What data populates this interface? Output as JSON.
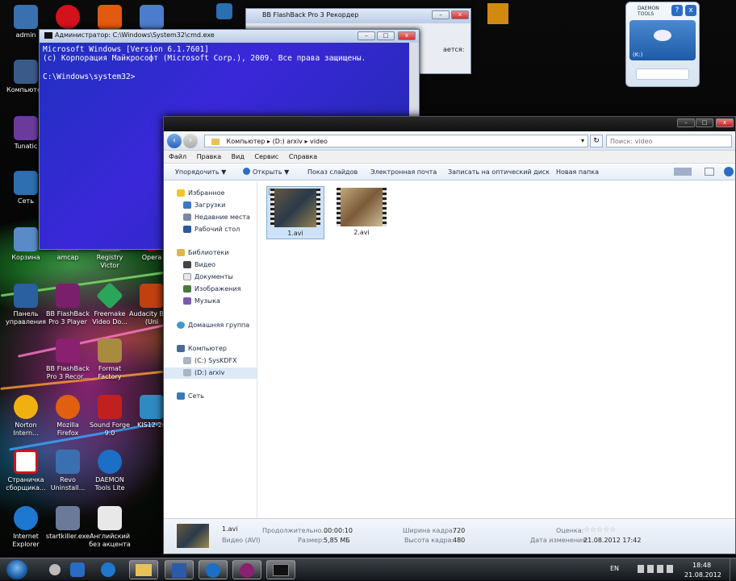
{
  "desktop": {
    "icons": [
      {
        "id": "admin",
        "label": "admin",
        "color": "#3a6fb0"
      },
      {
        "id": "opera",
        "label": "",
        "color": "#d3121b"
      },
      {
        "id": "tool",
        "label": "",
        "color": "#e05a10"
      },
      {
        "id": "search",
        "label": "",
        "color": "#4c7ccc"
      },
      {
        "id": "computer",
        "label": "Компьютер",
        "color": "#3a5a8a"
      },
      {
        "id": "tunatic",
        "label": "Tunatic",
        "color": "#6a3b9b"
      },
      {
        "id": "network",
        "label": "Сеть",
        "color": "#2d6fb0"
      },
      {
        "id": "recycle",
        "label": "Корзина",
        "color": "#5a8ac8"
      },
      {
        "id": "amcap",
        "label": "amcap",
        "color": "#666"
      },
      {
        "id": "registry",
        "label": "Registry Victor",
        "color": "#888"
      },
      {
        "id": "opera2",
        "label": "Opera",
        "color": "#c11"
      },
      {
        "id": "panel",
        "label": "Панель управления",
        "color": "#2a5fa0"
      },
      {
        "id": "bbplayer",
        "label": "BB FlashBack Pro 3 Player",
        "color": "#7a1f6b"
      },
      {
        "id": "freemake",
        "label": "Freemake Video Do...",
        "color": "#2aa65a"
      },
      {
        "id": "audacity",
        "label": "Audacity Beta (Uni",
        "color": "#c04010"
      },
      {
        "id": "bbrecorder",
        "label": "BB FlashBack Pro 3 Recor...",
        "color": "#8a2070"
      },
      {
        "id": "format",
        "label": "Format Factory",
        "color": "#a88a40"
      },
      {
        "id": "norton",
        "label": "Norton Intern...",
        "color": "#f0b010"
      },
      {
        "id": "firefox",
        "label": "Mozilla Firefox",
        "color": "#e06010"
      },
      {
        "id": "soundforge",
        "label": "Sound Forge 9.0",
        "color": "#c02020"
      },
      {
        "id": "kis",
        "label": "KIS12-20",
        "color": "#2f8ac2"
      },
      {
        "id": "strana",
        "label": "Страничка сборщика...",
        "color": "#d01616"
      },
      {
        "id": "revo",
        "label": "Revo Uninstall...",
        "color": "#3a70b0"
      },
      {
        "id": "daemonlite",
        "label": "DAEMON Tools Lite",
        "color": "#1b6fc4"
      },
      {
        "id": "ie",
        "label": "Internet Explorer",
        "color": "#1e78d0"
      },
      {
        "id": "startkiller",
        "label": "startkiller.exe",
        "color": "#6a7a98"
      },
      {
        "id": "english",
        "label": "Английский без акцента",
        "color": "#e8e8e8"
      }
    ]
  },
  "cmd": {
    "title": "Администратор: C:\\Windows\\System32\\cmd.exe",
    "lines": [
      "Microsoft Windows [Version 6.1.7601]",
      "(c) Корпорация Майкрософт (Microsoft Corp.), 2009. Все права защищены.",
      "",
      "C:\\Windows\\system32>"
    ],
    "min": "–",
    "max": "□",
    "close": "x"
  },
  "bbrec": {
    "title": "BB FlashBack Pro 3 Рекордер",
    "text": "ается:",
    "min": "–",
    "close": "x"
  },
  "daemon": {
    "brand": "DAEMON TOOLS",
    "drive": "(K:)",
    "help": "?",
    "close": "x"
  },
  "explorer": {
    "address": [
      "Компьютер",
      "(D:) arxiv",
      "video"
    ],
    "search_placeholder": "Поиск: video",
    "menu": [
      "Файл",
      "Правка",
      "Вид",
      "Сервис",
      "Справка"
    ],
    "toolbar": [
      "Упорядочить ▼",
      "Открыть ▼",
      "Показ слайдов",
      "Электронная почта",
      "Записать на оптический диск",
      "Новая папка"
    ],
    "nav": {
      "favorites": "Избранное",
      "downloads": "Загрузки",
      "recent": "Недавние места",
      "desktop": "Рабочий стол",
      "libraries": "Библиотеки",
      "video": "Видео",
      "docs": "Документы",
      "images": "Изображения",
      "music": "Музыка",
      "homegroup": "Домашняя группа",
      "computer": "Компьютер",
      "driveC": "(C:) SysKDFX",
      "driveD": "(D:) arxiv",
      "network": "Сеть"
    },
    "files": [
      {
        "name": "1.avi",
        "selected": true
      },
      {
        "name": "2.avi",
        "selected": false
      }
    ],
    "details": {
      "name": "1.avi",
      "type": "Видео (AVI)",
      "duration_label": "Продолжительно...",
      "duration": "00:00:10",
      "size_label": "Размер:",
      "size": "5,85 МБ",
      "width_label": "Ширина кадра:",
      "width": "720",
      "height_label": "Высота кадра:",
      "height": "480",
      "rating_label": "Оценка:",
      "rating_stars": "☆☆☆☆☆",
      "modified_label": "Дата изменения:",
      "modified": "21.08.2012 17:42"
    }
  },
  "taskbar": {
    "lang": "EN",
    "time": "18:48",
    "date": "21.08.2012"
  }
}
